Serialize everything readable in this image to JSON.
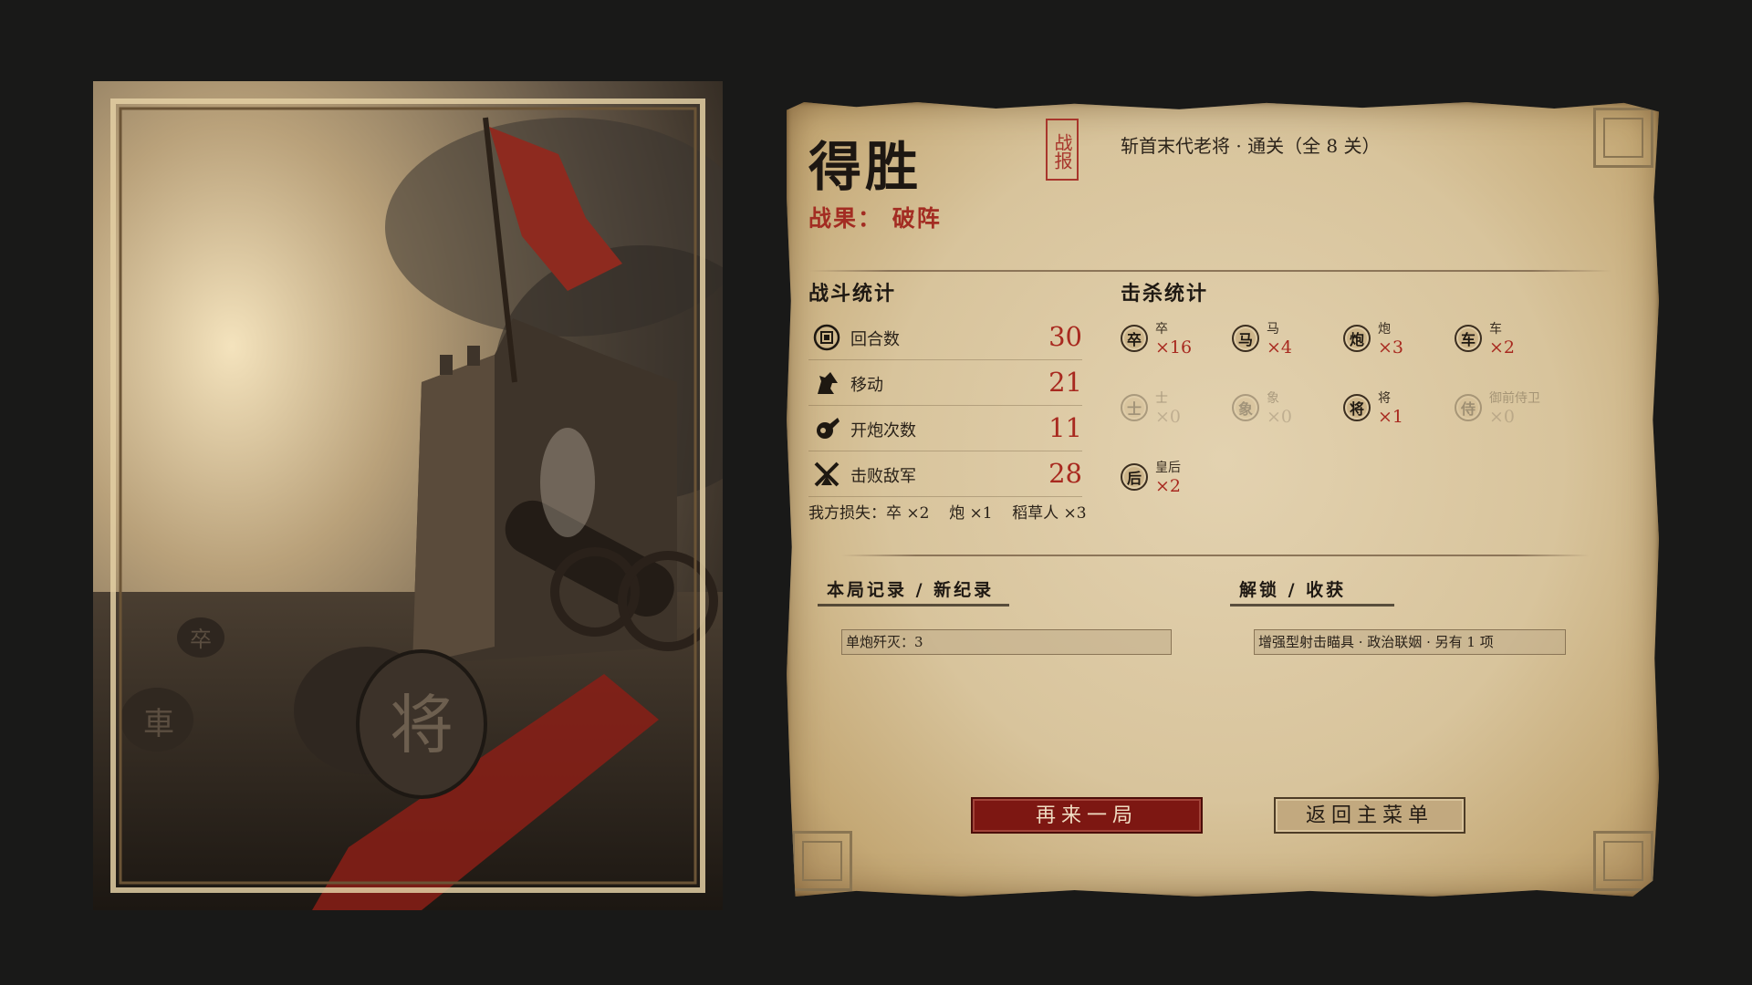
{
  "colors": {
    "accent_red": "#a8291f",
    "ink": "#1d1712",
    "parchment": "#d8c49c",
    "background": "#191918"
  },
  "art": {
    "piece_main": "将",
    "piece_left": "車",
    "piece_back": "卒"
  },
  "header": {
    "title": "得胜",
    "seal": "战报",
    "subtitle": "斩首末代老将 · 通关（全 8 关）",
    "result": "战果：  破阵"
  },
  "battle_stats": {
    "heading": "战斗统计",
    "rows": [
      {
        "icon": "round-icon",
        "label": "回合数",
        "value": "30"
      },
      {
        "icon": "horse-icon",
        "label": "移动",
        "value": "21"
      },
      {
        "icon": "cannon-fire-icon",
        "label": "开炮次数",
        "value": "11"
      },
      {
        "icon": "crossed-swords-icon",
        "label": "击败敌军",
        "value": "28"
      }
    ],
    "losses": "我方损失：卒 ×2    炮 ×1    稻草人 ×3"
  },
  "kill_stats": {
    "heading": "击杀统计",
    "items": [
      {
        "glyph": "卒",
        "name": "卒",
        "count": "×16",
        "faded": false
      },
      {
        "glyph": "马",
        "name": "马",
        "count": "×4",
        "faded": false
      },
      {
        "glyph": "炮",
        "name": "炮",
        "count": "×3",
        "faded": false
      },
      {
        "glyph": "车",
        "name": "车",
        "count": "×2",
        "faded": false
      },
      {
        "glyph": "士",
        "name": "士",
        "count": "×0",
        "faded": true
      },
      {
        "glyph": "象",
        "name": "象",
        "count": "×0",
        "faded": true
      },
      {
        "glyph": "将",
        "name": "将",
        "count": "×1",
        "faded": false
      },
      {
        "glyph": "侍",
        "name": "御前侍卫",
        "count": "×0",
        "faded": true
      },
      {
        "glyph": "后",
        "name": "皇后",
        "count": "×2",
        "faded": false
      }
    ]
  },
  "records": {
    "heading": "本局记录 / 新纪录",
    "entry": "单炮歼灭：3"
  },
  "unlocks": {
    "heading": "解锁 / 收获",
    "entry": "增强型射击瞄具 · 政治联姻 · 另有 1 项"
  },
  "buttons": {
    "again": "再来一局",
    "menu": "返回主菜单"
  }
}
